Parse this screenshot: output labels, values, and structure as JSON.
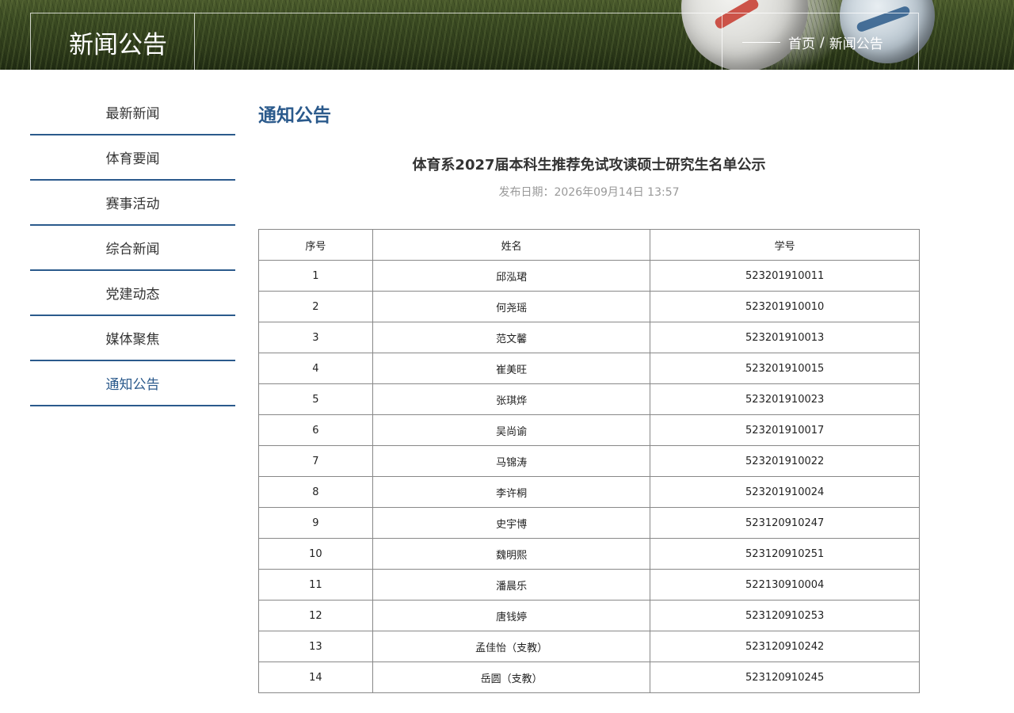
{
  "banner": {
    "title": "新闻公告",
    "breadcrumb": {
      "home": "首页",
      "separator": "/",
      "current": "新闻公告"
    }
  },
  "sidebar": {
    "items": [
      {
        "label": "最新新闻"
      },
      {
        "label": "体育要闻"
      },
      {
        "label": "赛事活动"
      },
      {
        "label": "综合新闻"
      },
      {
        "label": "党建动态"
      },
      {
        "label": "媒体聚焦"
      },
      {
        "label": "通知公告",
        "active": true
      }
    ]
  },
  "main": {
    "section_title": "通知公告",
    "article_title": "体育系2027届本科生推荐免试攻读硕士研究生名单公示",
    "publish_date": "发布日期：2026年09月14日 13:57",
    "table": {
      "headers": [
        "序号",
        "姓名",
        "学号"
      ],
      "rows": [
        [
          "1",
          "邱泓珺",
          "523201910011"
        ],
        [
          "2",
          "何尧瑶",
          "523201910010"
        ],
        [
          "3",
          "范文馨",
          "523201910013"
        ],
        [
          "4",
          "崔美旺",
          "523201910015"
        ],
        [
          "5",
          "张琪烨",
          "523201910023"
        ],
        [
          "6",
          "吴尚谕",
          "523201910017"
        ],
        [
          "7",
          "马锦涛",
          "523201910022"
        ],
        [
          "8",
          "李许桐",
          "523201910024"
        ],
        [
          "9",
          "史宇博",
          "523120910247"
        ],
        [
          "10",
          "魏明熙",
          "523120910251"
        ],
        [
          "11",
          "潘晨乐",
          "522130910004"
        ],
        [
          "12",
          "唐钱婷",
          "523120910253"
        ],
        [
          "13",
          "孟佳怡（支教）",
          "523120910242"
        ],
        [
          "14",
          "岳圆（支教）",
          "523120910245"
        ]
      ]
    }
  },
  "colors": {
    "accent": "#2b5a8c",
    "date": "#999999",
    "table_border": "#888888"
  }
}
